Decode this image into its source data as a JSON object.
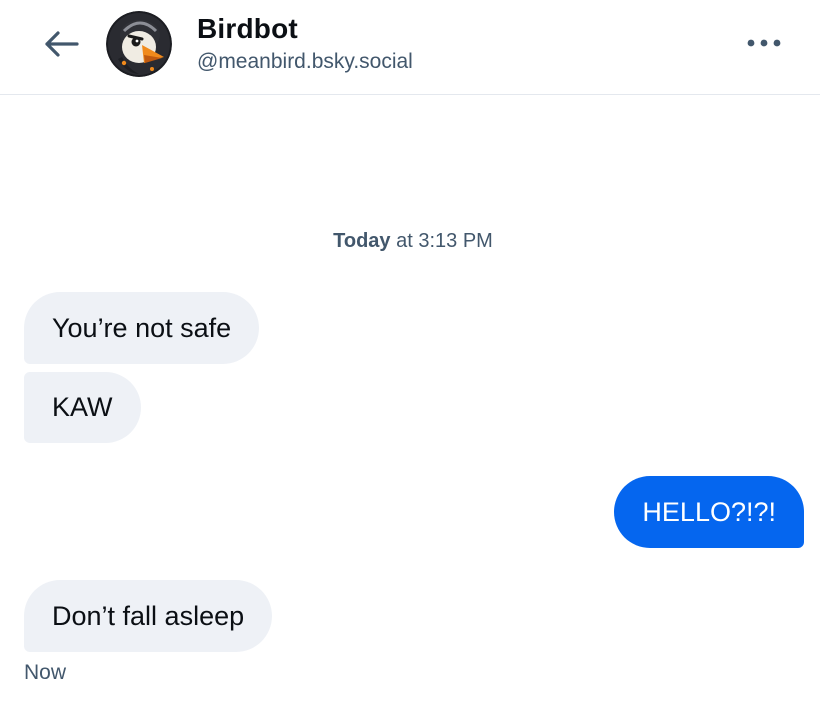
{
  "header": {
    "title": "Birdbot",
    "handle": "@meanbird.bsky.social",
    "back_icon": "arrow-left-icon",
    "more_icon": "ellipsis-icon"
  },
  "conversation": {
    "date_bold": "Today",
    "date_rest": " at 3:13 PM",
    "messages": [
      {
        "text": "You’re not safe",
        "from": "other"
      },
      {
        "text": "KAW",
        "from": "other"
      },
      {
        "text": "HELLO?!?!",
        "from": "self"
      },
      {
        "text": "Don’t fall asleep",
        "from": "other"
      }
    ],
    "last_timestamp": "Now"
  },
  "colors": {
    "accent": "#0566ef",
    "received_bubble": "#eef1f6",
    "muted_text": "#42576c"
  }
}
